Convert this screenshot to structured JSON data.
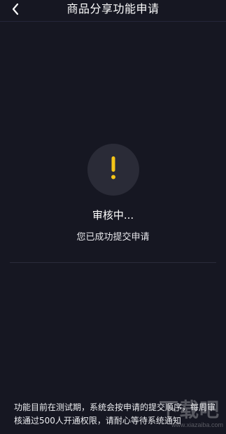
{
  "header": {
    "title": "商品分享功能申请",
    "back_icon": "chevron-left-icon"
  },
  "status": {
    "icon": "exclamation-icon",
    "icon_color": "#f5c518",
    "title": "审核中...",
    "subtitle": "您已成功提交申请"
  },
  "footer": {
    "note": "功能目前在测试期，系统会按申请的提交顺序，每周审核通过500人开通权限，请耐心等待系统通知"
  },
  "watermark": {
    "text": "下载吧",
    "url": "www.xiazaiba.com"
  },
  "colors": {
    "background": "#161722",
    "circle": "#2a2b37",
    "accent": "#f5c518"
  }
}
